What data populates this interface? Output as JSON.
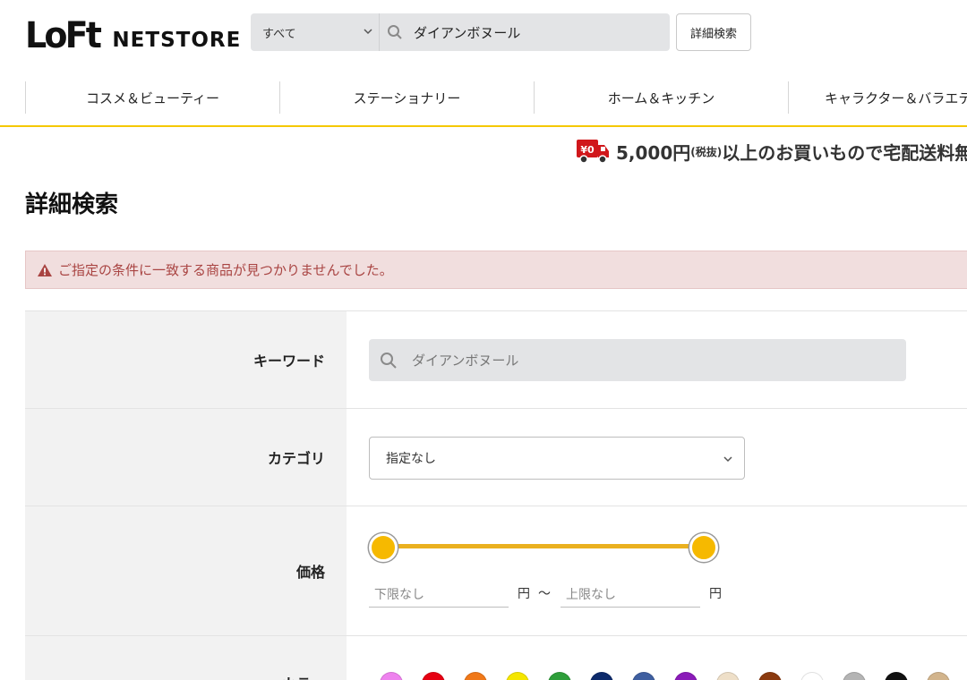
{
  "header": {
    "logo_main": "LoFt",
    "logo_sub": "NETSTORE",
    "search_scope": "すべて",
    "search_query": "ダイアンボヌール",
    "advanced_search_button": "詳細検索"
  },
  "nav": {
    "items": [
      {
        "label": "コスメ＆ビューティー"
      },
      {
        "label": "ステーショナリー"
      },
      {
        "label": "ホーム＆キッチン"
      },
      {
        "label": "キャラクター＆バラエテ"
      }
    ]
  },
  "promo": {
    "badge": "¥0",
    "amount": "5,000円",
    "tax_note": "(税抜)",
    "text": "以上のお買いもので宅配送料無"
  },
  "page_title": "詳細検索",
  "alert": {
    "message": "ご指定の条件に一致する商品が見つかりませんでした。"
  },
  "form": {
    "keyword": {
      "label": "キーワード",
      "value": "ダイアンボヌール"
    },
    "category": {
      "label": "カテゴリ",
      "selected": "指定なし"
    },
    "price": {
      "label": "価格",
      "min_placeholder": "下限なし",
      "max_placeholder": "上限なし",
      "unit": "円",
      "separator": "〜",
      "range_fraction": [
        0,
        1
      ]
    },
    "color": {
      "label": "カラー",
      "swatches": [
        "#ee82ee",
        "#e60012",
        "#f07818",
        "#f5e600",
        "#2e9e3a",
        "#0d2a6b",
        "#3f5fa0",
        "#8a1ab8",
        "#eedfc8",
        "#8b3a0f",
        "#ffffff",
        "#b4b4b4",
        "#111111",
        "#d2b48c"
      ]
    }
  },
  "colors": {
    "accent_yellow": "#f5c800",
    "slider": "#f6b900",
    "alert_text": "#a94442",
    "alert_bg": "#f1dede",
    "promo_red": "#d0171b"
  }
}
